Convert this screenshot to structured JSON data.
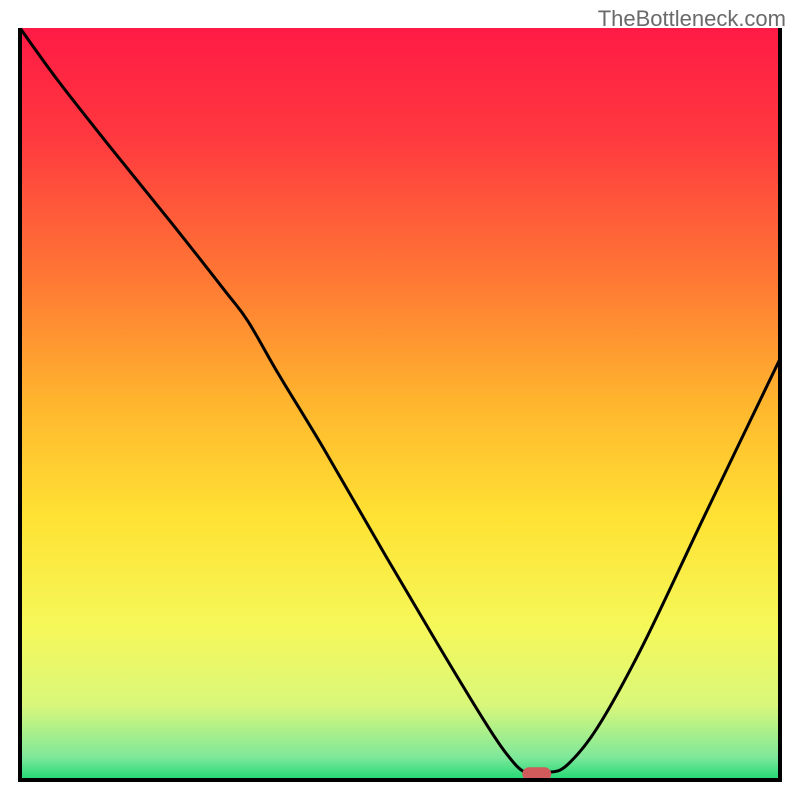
{
  "watermark": "TheBottleneck.com",
  "chart_data": {
    "type": "line",
    "title": "",
    "xlabel": "",
    "ylabel": "",
    "xlim": [
      0,
      100
    ],
    "ylim": [
      0,
      100
    ],
    "axes_visible": false,
    "grid": false,
    "background_gradient": {
      "type": "linear-vertical",
      "stops": [
        {
          "offset": 0.0,
          "color": "#ff1a45"
        },
        {
          "offset": 0.15,
          "color": "#ff3a3f"
        },
        {
          "offset": 0.35,
          "color": "#ff7e33"
        },
        {
          "offset": 0.5,
          "color": "#ffb62e"
        },
        {
          "offset": 0.65,
          "color": "#ffe233"
        },
        {
          "offset": 0.8,
          "color": "#f5f85a"
        },
        {
          "offset": 0.9,
          "color": "#d9f77a"
        },
        {
          "offset": 0.97,
          "color": "#7ee89a"
        },
        {
          "offset": 1.0,
          "color": "#1fd873"
        }
      ]
    },
    "series": [
      {
        "name": "bottleneck-curve",
        "color": "#000000",
        "stroke_width": 3,
        "x": [
          0.0,
          5.0,
          12.0,
          20.0,
          27.0,
          30.0,
          34.0,
          40.0,
          48.0,
          55.0,
          61.0,
          64.0,
          66.5,
          69.5,
          72.0,
          76.0,
          82.0,
          90.0,
          100.0
        ],
        "y": [
          100.0,
          93.0,
          84.0,
          74.0,
          65.0,
          61.0,
          54.0,
          44.0,
          30.0,
          18.0,
          8.0,
          3.5,
          1.0,
          1.0,
          2.0,
          7.0,
          18.0,
          35.0,
          56.0
        ]
      }
    ],
    "marker": {
      "name": "optimal-point",
      "shape": "rounded-pill",
      "color": "#d15a5a",
      "x": 68.0,
      "y": 0.8,
      "width_pct": 3.8,
      "height_pct": 1.8
    },
    "frame": {
      "stroke": "#000000",
      "stroke_width": 4,
      "sides": [
        "left",
        "bottom",
        "right"
      ]
    }
  }
}
